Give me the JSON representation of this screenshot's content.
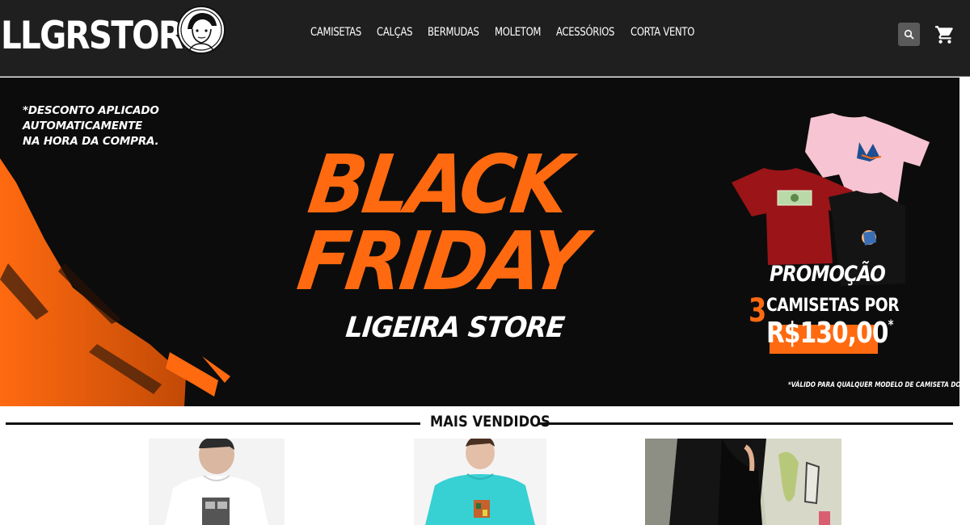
{
  "header": {
    "logo_text": "LLGRSTORE",
    "nav": [
      "CAMISETAS",
      "CALÇAS",
      "BERMUDAS",
      "MOLETOM",
      "ACESSÓRIOS",
      "CORTA VENTO"
    ],
    "search_icon": "search-icon",
    "cart_icon": "cart-icon"
  },
  "banner": {
    "note": [
      "*DESCONTO APLICADO",
      "AUTOMATICAMENTE",
      "NA HORA DA COMPRA."
    ],
    "title_line1": "BLACK",
    "title_line2": "FRIDAY",
    "store": "LIGEIRA STORE",
    "promo_title": "PROMOÇÃO",
    "promo_number": "3",
    "promo_line": "CAMISETAS POR",
    "promo_price": "R$130,00",
    "promo_price_mark": "*",
    "promo_footnote": "*VÁLIDO PARA QUALQUER MODELO DE CAMISETA DO SITE",
    "accent_color": "#ff6a10"
  },
  "section": {
    "title": "MAIS VENDIDOS"
  }
}
